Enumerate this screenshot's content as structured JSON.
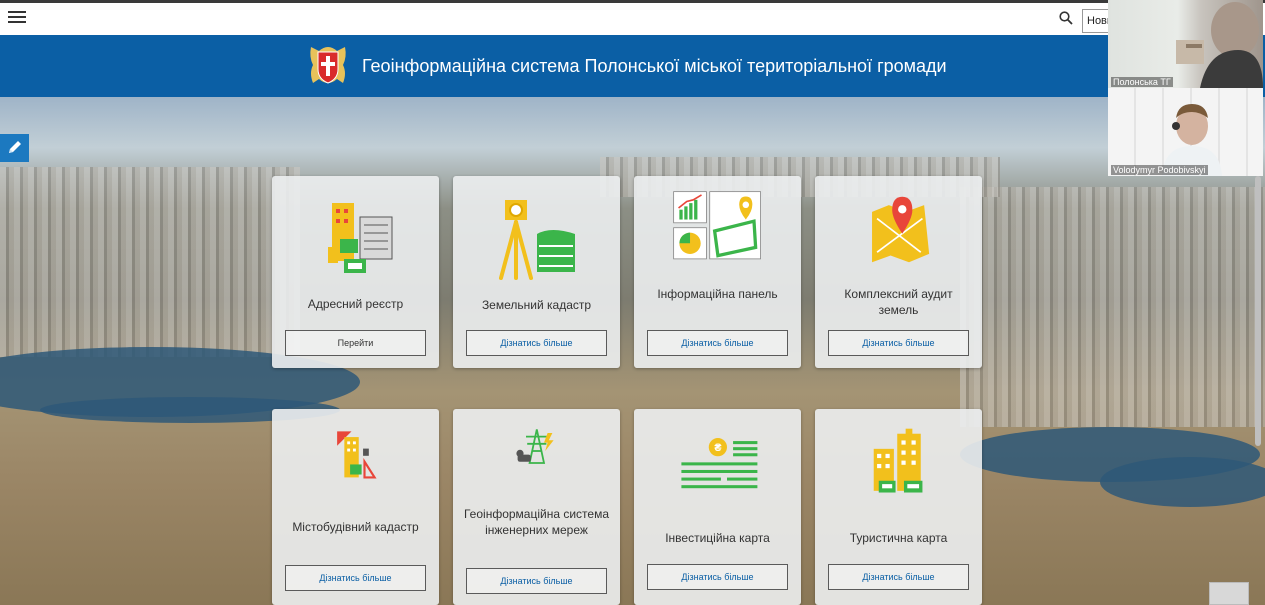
{
  "topbar": {
    "search_value": "Нови"
  },
  "banner": {
    "title": "Геоінформаційна система Полонської міської територіальної громади"
  },
  "cards": [
    {
      "title": "Адресний реєстр",
      "button": "Перейти",
      "icon": "address-registry-icon"
    },
    {
      "title": "Земельний кадастр",
      "button": "Дізнатись більше",
      "icon": "land-cadastre-icon"
    },
    {
      "title": "Інформаційна панель",
      "button": "Дізнатись більше",
      "icon": "dashboard-icon"
    },
    {
      "title": "Комплексний аудит земель",
      "button": "Дізнатись більше",
      "icon": "map-pin-icon"
    },
    {
      "title": "Містобудівний кадастр",
      "button": "Дізнатись більше",
      "icon": "urban-planning-icon"
    },
    {
      "title": "Геоінформаційна система інженерних мереж",
      "button": "Дізнатись більше",
      "icon": "power-tower-icon"
    },
    {
      "title": "Інвестиційна карта",
      "button": "Дізнатись більше",
      "icon": "coin-stack-icon"
    },
    {
      "title": "Туристична карта",
      "button": "Дізнатись більше",
      "icon": "city-buildings-icon"
    }
  ],
  "video_tiles": [
    {
      "name": "Полонська ТГ"
    },
    {
      "name": "Volodymyr Podobivskyi"
    }
  ],
  "colors": {
    "banner": "#0b5fa5",
    "accent_yellow": "#f2c01c",
    "accent_green": "#3bb54a",
    "accent_red": "#e8463a"
  }
}
